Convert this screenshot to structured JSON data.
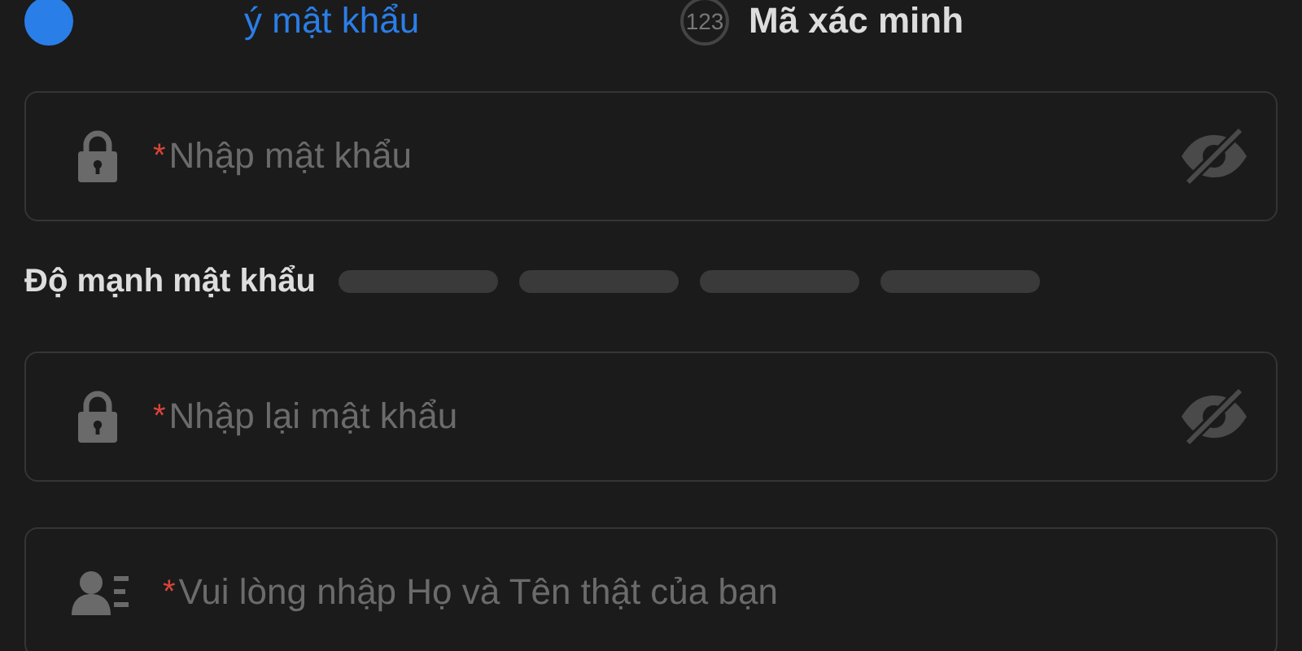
{
  "steps": [
    {
      "label": "ý mật khẩu",
      "selected": true
    },
    {
      "number": "123",
      "label": "Mã xác minh",
      "selected": false
    }
  ],
  "fields": [
    {
      "kind": "password",
      "marker": "*",
      "placeholder": "Nhập mật khẩu",
      "visibility_toggle": true
    },
    {
      "kind": "strength",
      "label": "Độ mạnh mật khẩu"
    },
    {
      "kind": "password",
      "marker": "*",
      "placeholder": "Nhập lại mật khẩu",
      "visibility_toggle": true
    },
    {
      "kind": "name",
      "marker": "*",
      "placeholder": "Vui lòng nhập Họ và Tên thật của bạn",
      "visibility_toggle": false
    }
  ]
}
